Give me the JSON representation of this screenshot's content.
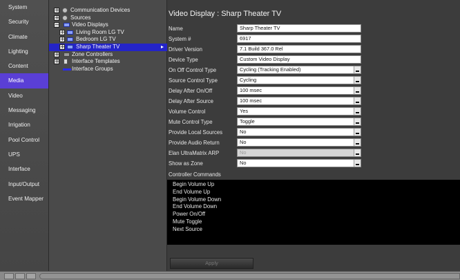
{
  "nav": {
    "items": [
      {
        "label": "System"
      },
      {
        "label": "Security"
      },
      {
        "label": "Climate"
      },
      {
        "label": "Lighting"
      },
      {
        "label": "Content"
      },
      {
        "label": "Media",
        "active": true
      },
      {
        "label": "Video"
      },
      {
        "label": "Messaging"
      },
      {
        "label": "Irrigation"
      },
      {
        "label": "Pool Control"
      },
      {
        "label": "UPS"
      },
      {
        "label": "Interface"
      },
      {
        "label": "Input/Output"
      },
      {
        "label": "Event Mapper"
      }
    ]
  },
  "tree": {
    "items": [
      {
        "label": "Communication Devices",
        "icon": "gear-icon"
      },
      {
        "label": "Sources",
        "icon": "speaker-icon"
      },
      {
        "label": "Video Displays",
        "icon": "folder-icon"
      },
      {
        "label": "Living Room LG TV",
        "icon": "tv-icon"
      },
      {
        "label": "Bedroom LG TV",
        "icon": "tv-icon"
      },
      {
        "label": "Sharp Theater TV",
        "icon": "tv-icon",
        "selected": true
      },
      {
        "label": "Zone Controllers",
        "icon": "zone-icon"
      },
      {
        "label": "Interface Templates",
        "icon": "template-icon"
      },
      {
        "label": "Interface Groups",
        "icon": "group-icon"
      }
    ]
  },
  "main": {
    "title": "Video Display : Sharp Theater TV",
    "properties": [
      {
        "label": "Name",
        "value": "Sharp Theater TV",
        "type": "text"
      },
      {
        "label": "System #",
        "value": "6917",
        "type": "text"
      },
      {
        "label": "Driver Version",
        "value": "7.1 Build 367.0 Rel",
        "type": "text"
      },
      {
        "label": "Device Type",
        "value": "Custom Video Display",
        "type": "text"
      },
      {
        "label": "On Off Control Type",
        "value": "Cycling (Tracking Enabled)",
        "type": "select"
      },
      {
        "label": "Source Control Type",
        "value": "Cycling",
        "type": "select"
      },
      {
        "label": "Delay After On/Off",
        "value": "100 msec",
        "type": "select"
      },
      {
        "label": "Delay After Source",
        "value": "100 msec",
        "type": "select"
      },
      {
        "label": "Volume Control",
        "value": "Yes",
        "type": "select"
      },
      {
        "label": "Mute Control Type",
        "value": "Toggle",
        "type": "select"
      },
      {
        "label": "Provide Local Sources",
        "value": "No",
        "type": "select"
      },
      {
        "label": "Provide Audio Return",
        "value": "No",
        "type": "select"
      },
      {
        "label": "Elan UltraMatrix ARP",
        "value": "No",
        "type": "select",
        "disabled": true
      },
      {
        "label": "Show as Zone",
        "value": "No",
        "type": "select"
      }
    ],
    "commands_label": "Controller Commands",
    "commands": [
      "Begin Volume Up",
      "End Volume Up",
      "Begin Volume Down",
      "End Volume Down",
      "Power On/Off",
      "Mute Toggle",
      "Next Source"
    ],
    "apply_label": "Apply"
  },
  "colors": {
    "active_nav": "#5a3fd6",
    "selected_tree": "#2424c8",
    "panel_bg": "#3c3c3c"
  }
}
